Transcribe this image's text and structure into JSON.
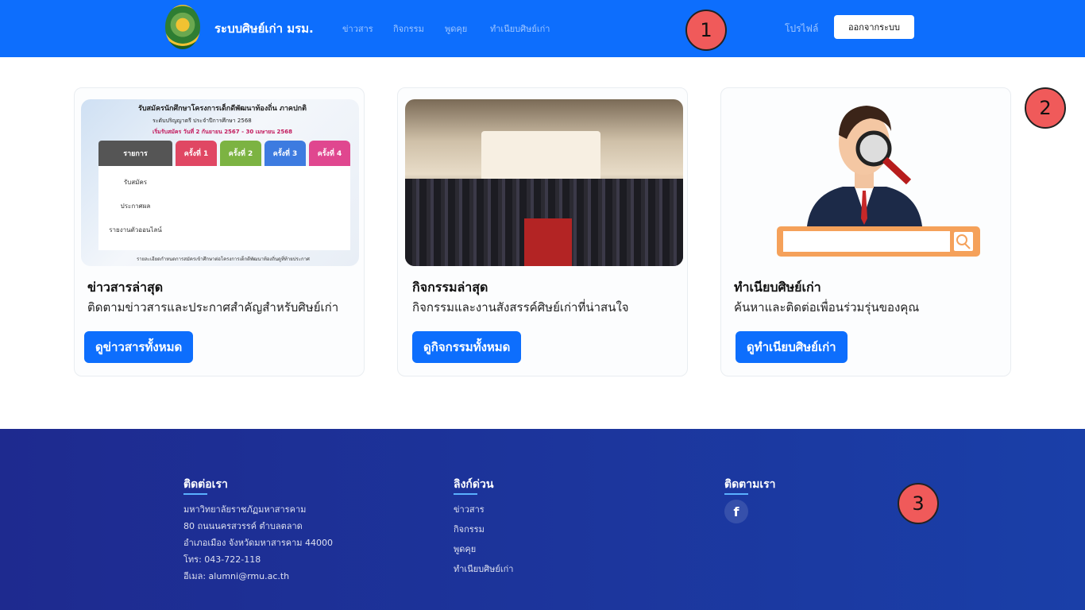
{
  "navbar": {
    "brand": "ระบบศิษย์เก่า มรม.",
    "links": [
      "ข่าวสาร",
      "กิจกรรม",
      "พูดคุย",
      "ทำเนียบศิษย์เก่า"
    ],
    "profile_label": "โปรไฟล์",
    "logout_label": "ออกจากระบบ"
  },
  "markers": [
    "1",
    "2",
    "3"
  ],
  "cards": [
    {
      "title": "ข่าวสารล่าสุด",
      "text": "ติดตามข่าวสารและประกาศสำคัญสำหรับศิษย์เก่า",
      "button": "ดูข่าวสารทั้งหมด"
    },
    {
      "title": "กิจกรรมล่าสุด",
      "text": "กิจกรรมและงานสังสรรค์ศิษย์เก่าที่น่าสนใจ",
      "button": "ดูกิจกรรมทั้งหมด"
    },
    {
      "title": "ทำเนียบศิษย์เก่า",
      "text": "ค้นหาและติดต่อเพื่อนร่วมรุ่นของคุณ",
      "button": "ดูทำเนียบศิษย์เก่า"
    }
  ],
  "news_image": {
    "title": "รับสมัครนักศึกษาโครงการเด็กดีพัฒนาท้องถิ่น ภาคปกติ",
    "subtitle": "ระดับปริญญาตรี ประจำปีการศึกษา 2568",
    "dates": "เริ่มรับสมัคร วันที่ 2 กันยายน 2567 - 30 เมษายน 2568",
    "header_label": "รายการ",
    "rounds": [
      "ครั้งที่ 1",
      "ครั้งที่ 2",
      "ครั้งที่ 3",
      "ครั้งที่ 4"
    ],
    "rows": [
      "รับสมัคร",
      "ประกาศผล",
      "รายงานตัวออนไลน์"
    ],
    "footnote": "รายละเอียดกำหนดการสมัครเข้าศึกษาต่อโครงการเด็กดีพัฒนาท้องถิ่นดูที่ท้ายประกาศ"
  },
  "footer": {
    "contact": {
      "heading": "ติดต่อเรา",
      "lines": [
        "มหาวิทยาลัยราชภัฏมหาสารคาม",
        "80 ถนนนครสวรรค์ ตำบลตลาด",
        "อำเภอเมือง จังหวัดมหาสารคาม 44000",
        "โทร: 043-722-118",
        "อีเมล: alumni@rmu.ac.th"
      ]
    },
    "quick_links": {
      "heading": "ลิงก์ด่วน",
      "items": [
        "ข่าวสาร",
        "กิจกรรม",
        "พูดคุย",
        "ทำเนียบศิษย์เก่า"
      ]
    },
    "follow": {
      "heading": "ติดตามเรา",
      "facebook_glyph": "f"
    }
  },
  "colors": {
    "primary": "#0d6efd",
    "footer_start": "#1e2a8f",
    "footer_end": "#1a3fa8",
    "marker": "#f05a5a"
  }
}
